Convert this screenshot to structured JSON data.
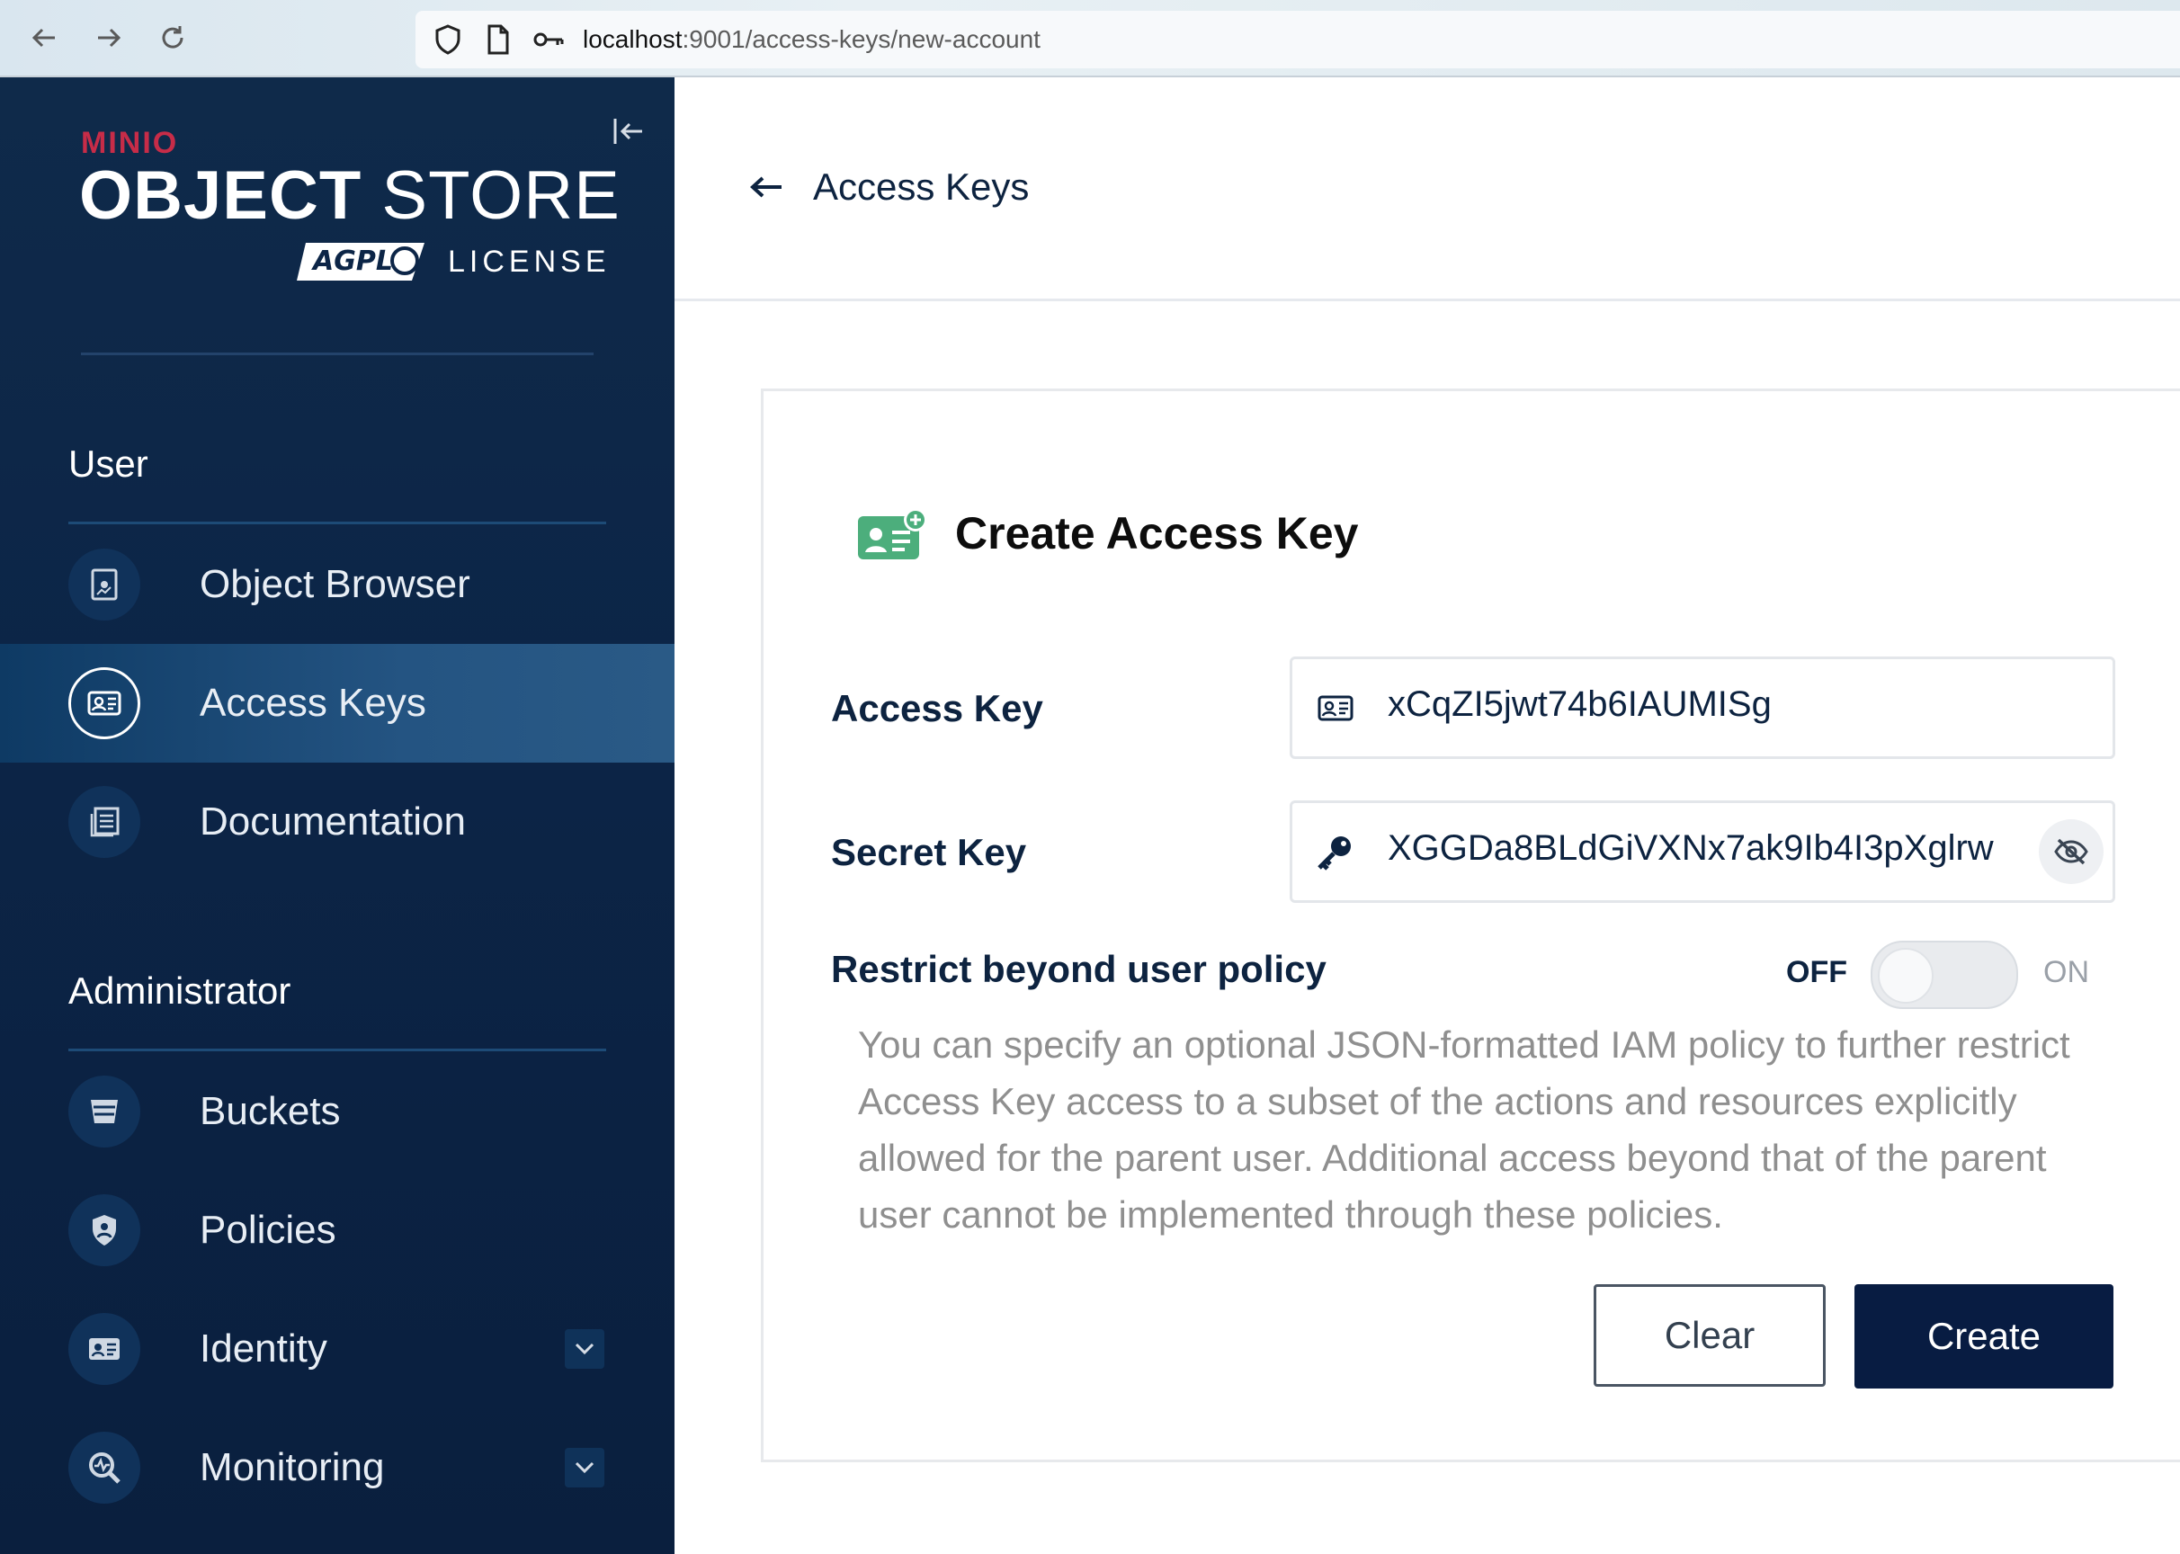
{
  "browser": {
    "url_host": "localhost",
    "url_path": ":9001/access-keys/new-account"
  },
  "sidebar": {
    "logo_brand": "MINIO",
    "logo_title_bold": "OBJECT",
    "logo_title_light": "STORE",
    "logo_badge": "AGPL",
    "logo_license": "LICENSE",
    "sections": [
      {
        "heading": "User",
        "items": [
          {
            "label": "Object Browser",
            "icon": "object-browser-icon"
          },
          {
            "label": "Access Keys",
            "icon": "access-keys-icon",
            "active": true
          },
          {
            "label": "Documentation",
            "icon": "documentation-icon"
          }
        ]
      },
      {
        "heading": "Administrator",
        "items": [
          {
            "label": "Buckets",
            "icon": "buckets-icon"
          },
          {
            "label": "Policies",
            "icon": "policies-icon"
          },
          {
            "label": "Identity",
            "icon": "identity-icon",
            "expandable": true
          },
          {
            "label": "Monitoring",
            "icon": "monitoring-icon",
            "expandable": true
          }
        ]
      }
    ]
  },
  "header": {
    "back_label": "Access Keys"
  },
  "form": {
    "title": "Create Access Key",
    "access_key_label": "Access Key",
    "access_key_value": "xCqZI5jwt74b6IAUMISg",
    "secret_key_label": "Secret Key",
    "secret_key_value": "XGGDa8BLdGiVXNx7ak9Ib4I3pXglrw",
    "restrict_label": "Restrict beyond user policy",
    "toggle_off": "OFF",
    "toggle_on": "ON",
    "toggle_state": false,
    "help_text": "You can specify an optional JSON-formatted IAM policy to further restrict Access Key access to a subset of the actions and resources explicitly allowed for the parent user. Additional access beyond that of the parent user cannot be implemented through these policies.",
    "clear_label": "Clear",
    "create_label": "Create"
  },
  "colors": {
    "sidebar_bg": "#0c2547",
    "active_item": "#245482",
    "brand_red": "#c72c48",
    "primary_button": "#081c42",
    "card_icon_green": "#4cae7c"
  }
}
